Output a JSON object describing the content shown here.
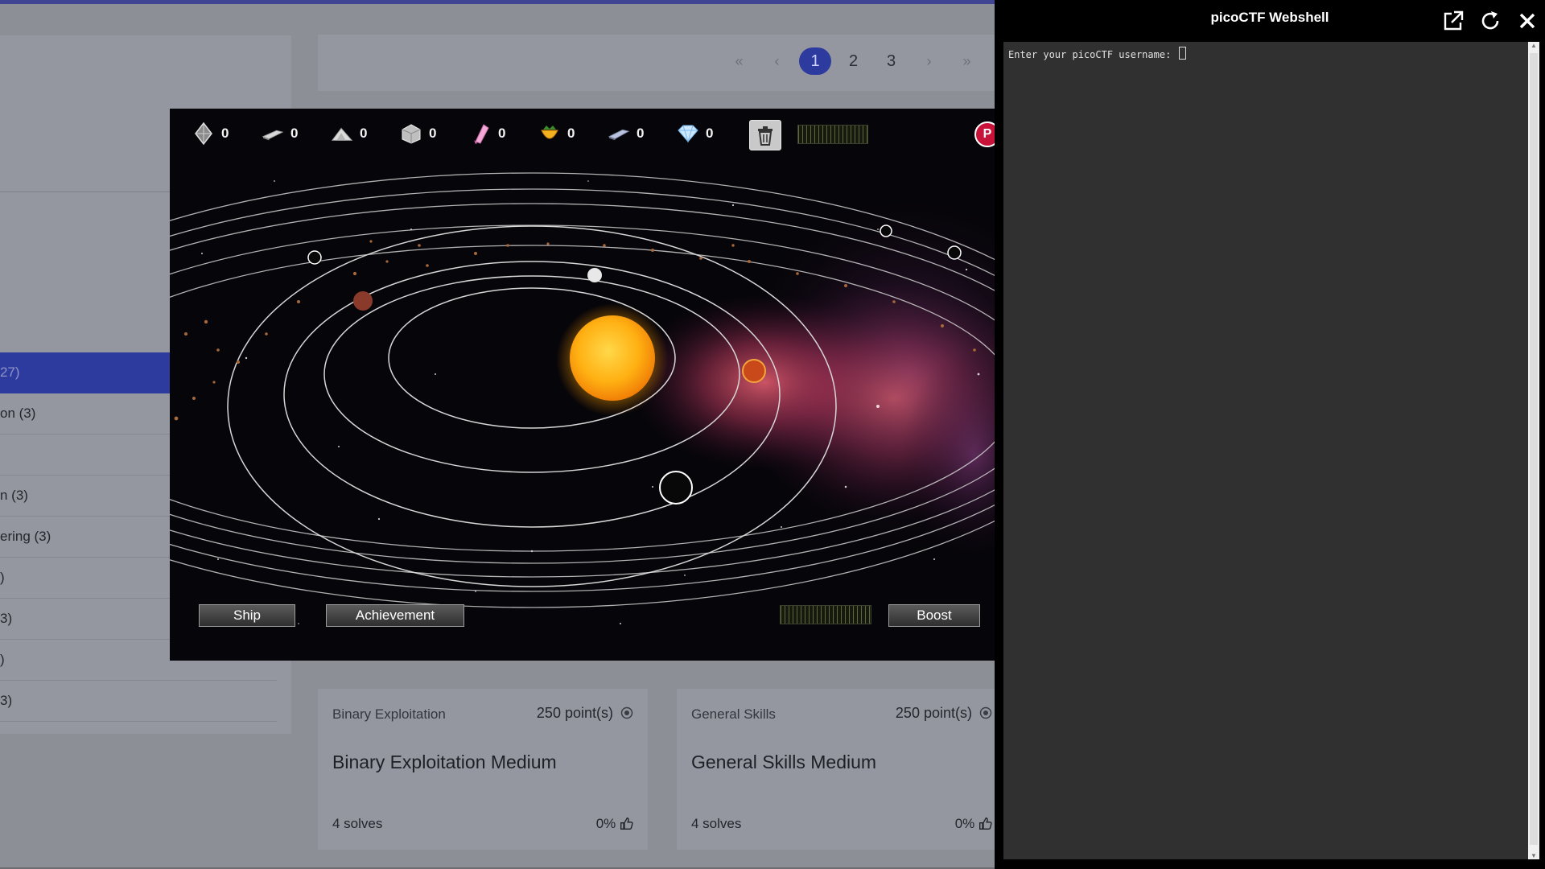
{
  "sidebar": {
    "categories": [
      {
        "label": "27)",
        "active": true
      },
      {
        "label": "on (3)",
        "active": false
      },
      {
        "label": "",
        "active": false
      },
      {
        "label": "n (3)",
        "active": false
      },
      {
        "label": "ering (3)",
        "active": false
      },
      {
        "label": ")",
        "active": false
      },
      {
        "label": "3)",
        "active": false
      },
      {
        "label": ")",
        "active": false
      },
      {
        "label": "3)",
        "active": false
      }
    ]
  },
  "pagination": {
    "first": "«",
    "prev": "‹",
    "pages": [
      "1",
      "2",
      "3"
    ],
    "current": "1",
    "next": "›",
    "last": "»"
  },
  "cards": [
    {
      "category": "Binary Exploitation",
      "points": "250 point(s)",
      "title": "Binary Exploitation Medium",
      "solves": "4 solves",
      "rating": "0%"
    },
    {
      "category": "General Skills",
      "points": "250 point(s)",
      "title": "General Skills Medium",
      "solves": "4 solves",
      "rating": "0%"
    }
  ],
  "game": {
    "resources": [
      {
        "icon": "crystal-icon",
        "count": "0"
      },
      {
        "icon": "metal-bar-icon",
        "count": "0"
      },
      {
        "icon": "rock-pile-icon",
        "count": "0"
      },
      {
        "icon": "cube-ore-icon",
        "count": "0"
      },
      {
        "icon": "pink-crystal-icon",
        "count": "0"
      },
      {
        "icon": "fruit-icon",
        "count": "0"
      },
      {
        "icon": "silver-bar-icon",
        "count": "0"
      },
      {
        "icon": "diamond-icon",
        "count": "0"
      }
    ],
    "buttons": {
      "ship": "Ship",
      "achievement": "Achievement",
      "boost": "Boost"
    },
    "logo_letter": "P"
  },
  "webshell": {
    "title": "picoCTF Webshell",
    "prompt": "Enter your picoCTF username:"
  },
  "colors": {
    "accent": "#2d3a9e",
    "terminal_bg": "#303030",
    "sun": "#f7b21a"
  }
}
